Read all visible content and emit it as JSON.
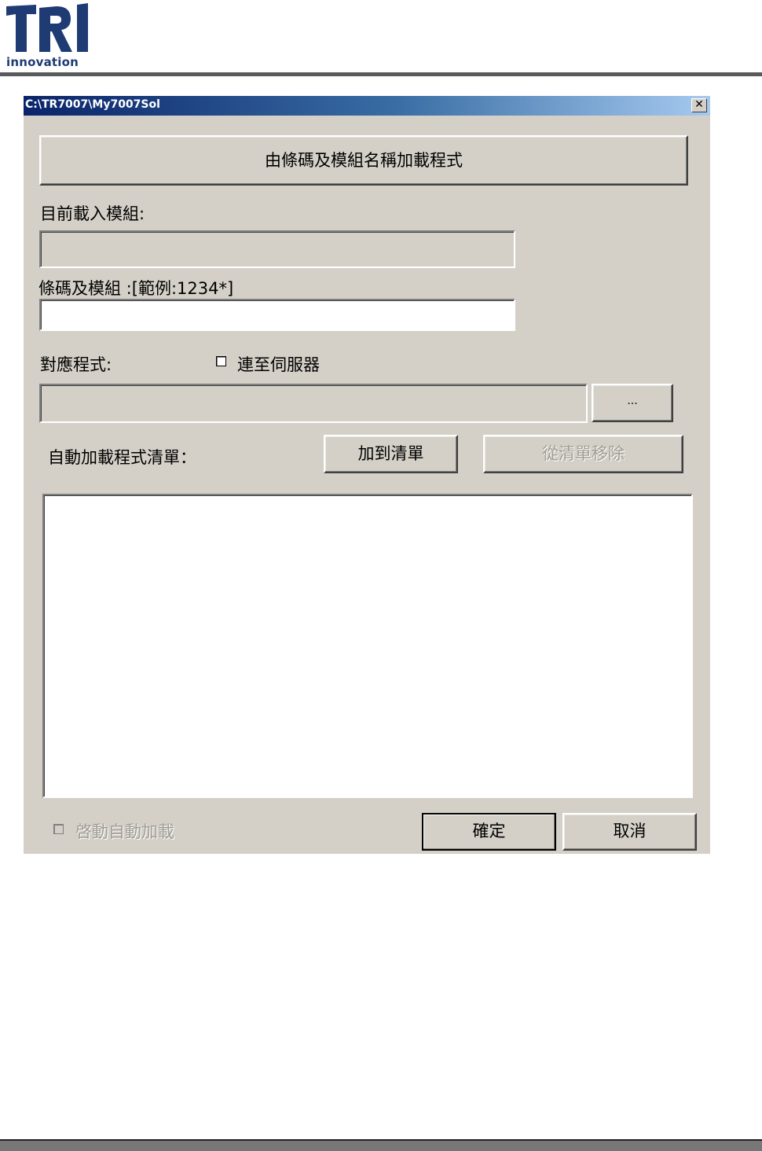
{
  "header": {
    "logo_text": "innovation",
    "logo_mark_text": "TRI"
  },
  "dialog": {
    "title": "C:\\TR7007\\My7007Sol",
    "close_glyph": "✕",
    "load_button_label": "由條碼及模組名稱加載程式",
    "current_module_label": "目前載入模組:",
    "current_module_value": "",
    "barcode_label": "條碼及模組 :[範例:1234*]",
    "barcode_value": "",
    "program_label": "對應程式:",
    "connect_server_label": "連至伺服器",
    "connect_server_checked": false,
    "program_path_value": "",
    "browse_button_label": "...",
    "autoload_list_label": "自動加載程式清單：",
    "add_to_list_label": "加到清單",
    "remove_from_list_label": "從清單移除",
    "autoload_items": [],
    "enable_autoload_label": "啓動自動加載",
    "enable_autoload_checked": false,
    "ok_label": "確定",
    "cancel_label": "取消"
  },
  "colors": {
    "dialog_face": "#d4d0c8",
    "titlebar_start": "#0a246a",
    "titlebar_end": "#a6caf0",
    "logo_blue": "#1f3b73"
  }
}
